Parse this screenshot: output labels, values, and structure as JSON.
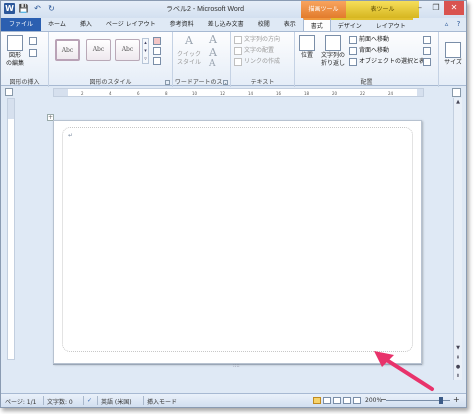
{
  "titlebar": {
    "title": "ラベル2 - Microsoft Word",
    "context_drawing": "描画ツール",
    "context_table": "表ツール",
    "qat": {
      "save": "💾",
      "undo": "↶",
      "redo": "↻"
    },
    "window_buttons": {
      "minimize": "–",
      "restore": "❐",
      "close": "✕"
    }
  },
  "tabs": [
    "ファイル",
    "ホーム",
    "挿入",
    "ページ レイアウト",
    "参考資料",
    "差し込み文書",
    "校閲",
    "表示",
    "書式",
    "デザイン",
    "レイアウト"
  ],
  "ribbon": {
    "insert_shapes": {
      "edit_label": "図形",
      "edit_sub": "の編集",
      "group": "図形の挿入"
    },
    "shape_styles": {
      "style1": "Abc",
      "style2": "Abc",
      "style3": "Abc",
      "group": "図形のスタイル"
    },
    "wordart": {
      "quick_style_1": "クイック",
      "quick_style_2": "スタイル",
      "group": "ワードアートのス..."
    },
    "text": {
      "direction": "文字列の方向",
      "align": "文字の配置",
      "link": "リンクの作成",
      "group": "テキスト"
    },
    "arrange": {
      "position": "位置",
      "wrap_1": "文字列の",
      "wrap_2": "折り返し",
      "bring_forward": "前面へ移動",
      "send_backward": "背面へ移動",
      "selection_pane": "オブジェクトの選択と表示",
      "group": "配置"
    },
    "size": {
      "label": "サイズ"
    }
  },
  "ruler": {
    "ticks": [
      "2",
      "4",
      "6",
      "8",
      "10",
      "12",
      "14",
      "16",
      "18",
      "20",
      "22",
      "24"
    ]
  },
  "document": {
    "paragraph_mark": "↵",
    "table_handle": "+",
    "grip": "::::"
  },
  "statusbar": {
    "page": "ページ: 1/1",
    "words": "文字数: 0",
    "language": "英語 (米国)",
    "insert_mode": "挿入モード",
    "zoom": "200%",
    "zoom_minus": "−",
    "zoom_plus": "+"
  },
  "colors": {
    "accent": "#2b5fb0",
    "context_drawing": "#e27b2b",
    "context_table": "#d6b620",
    "annotation_arrow": "#e8336b"
  },
  "zoom_slider_level": 0.88
}
